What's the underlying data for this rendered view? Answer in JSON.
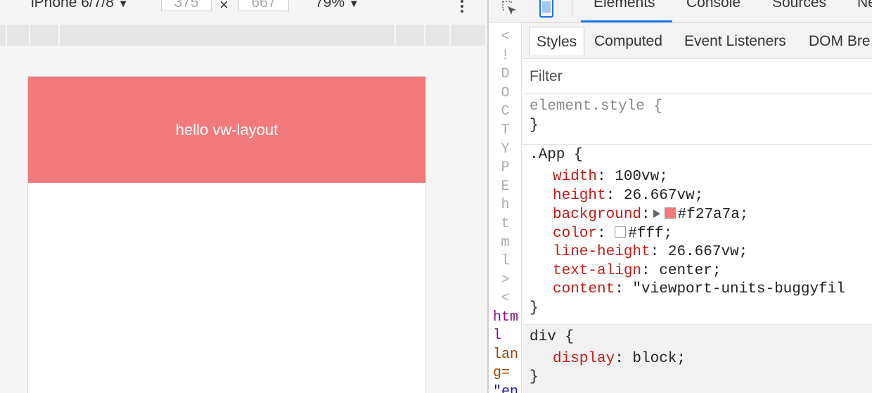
{
  "device_toolbar": {
    "device": "iPhone 6/7/8",
    "width": "375",
    "height": "667",
    "times": "×",
    "zoom": "79%",
    "dropdown_glyph": "▼"
  },
  "viewport": {
    "banner_text": "hello vw-layout",
    "banner_color": "#f27a7a"
  },
  "devtools": {
    "tabs": [
      "Elements",
      "Console",
      "Sources",
      "Ne"
    ],
    "active_tab": "Elements",
    "accent": "#1a73e8",
    "dom": {
      "doctype_chars": [
        "<",
        "!",
        "D",
        "O",
        "C",
        "T",
        "Y",
        "P",
        "E",
        "h",
        "t",
        "m",
        "l",
        ">",
        "<"
      ],
      "lines": [
        "htm",
        "l",
        "lan",
        "g=",
        "\"en"
      ]
    },
    "styles": {
      "sub_tabs": [
        "Styles",
        "Computed",
        "Event Listeners",
        "DOM Bre"
      ],
      "filter_placeholder": "Filter",
      "element_style": {
        "selector": "element.style {",
        "close": "}"
      },
      "app_rule": {
        "selector": ".App {",
        "decls": [
          {
            "name": "width",
            "value": " 100vw;"
          },
          {
            "name": "height",
            "value": " 26.667vw;"
          },
          {
            "name": "background",
            "value": "#f27a7a;"
          },
          {
            "name": "color",
            "value": "#fff;"
          },
          {
            "name": "line-height",
            "value": " 26.667vw;"
          },
          {
            "name": "text-align",
            "value": " center;"
          },
          {
            "name": "content",
            "value": " \"viewport-units-buggyfil"
          }
        ],
        "close": "}",
        "bg_swatch": "#f27a7a",
        "color_swatch": "#ffffff"
      },
      "div_rule": {
        "selector": "div {",
        "decl": {
          "name": "display",
          "value": " block;"
        },
        "close": "}"
      }
    }
  }
}
